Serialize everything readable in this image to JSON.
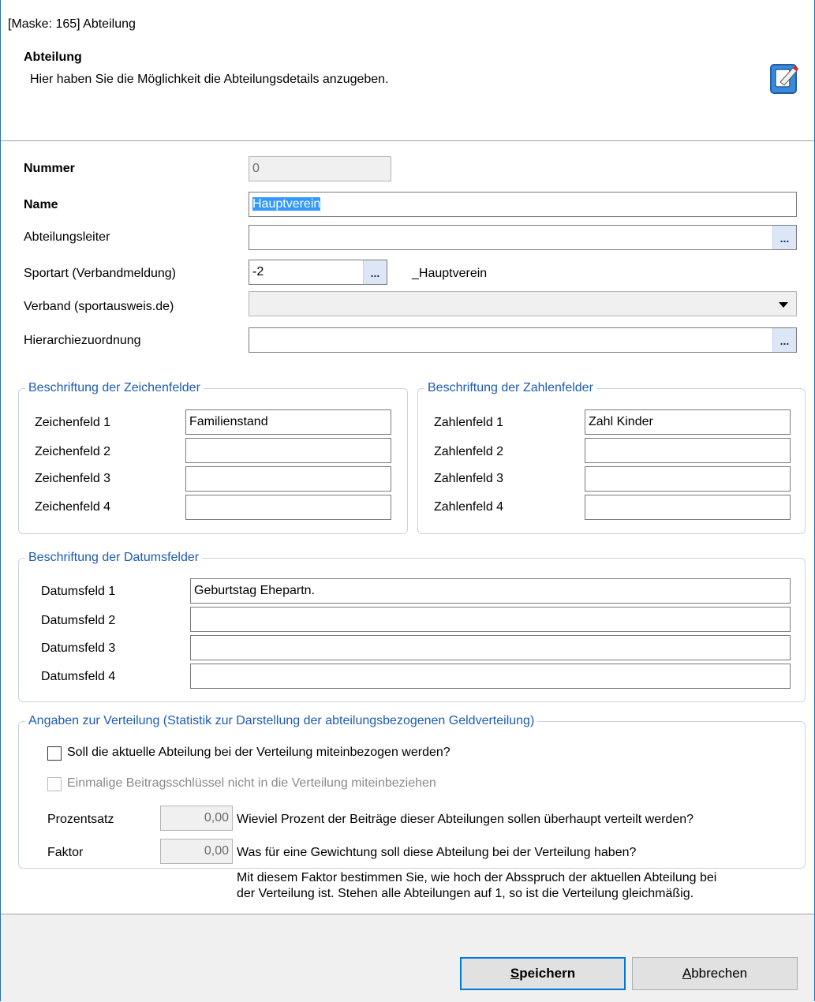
{
  "window": {
    "title": "[Maske: 165] Abteilung"
  },
  "header": {
    "title": "Abteilung",
    "subtitle": "Hier haben Sie die Möglichkeit die Abteilungsdetails anzugeben.",
    "icon": "edit-form-icon"
  },
  "form": {
    "nummer": {
      "label": "Nummer",
      "value": "0"
    },
    "name": {
      "label": "Name",
      "value": "Hauptverein"
    },
    "abteilungsleiter": {
      "label": "Abteilungsleiter",
      "value": "",
      "button": "..."
    },
    "sportart": {
      "label": "Sportart (Verbandmeldung)",
      "value": "-2",
      "button": "...",
      "description": "_Hauptverein"
    },
    "verband": {
      "label": "Verband (sportausweis.de)",
      "value": ""
    },
    "hierarchie": {
      "label": "Hierarchiezuordnung",
      "value": "",
      "button": "..."
    }
  },
  "zeichenfelder": {
    "legend": "Beschriftung der Zeichenfelder",
    "fields": [
      {
        "label": "Zeichenfeld 1",
        "value": "Familienstand"
      },
      {
        "label": "Zeichenfeld 2",
        "value": ""
      },
      {
        "label": "Zeichenfeld 3",
        "value": ""
      },
      {
        "label": "Zeichenfeld 4",
        "value": ""
      }
    ]
  },
  "zahlenfelder": {
    "legend": "Beschriftung der Zahlenfelder",
    "fields": [
      {
        "label": "Zahlenfeld 1",
        "value": "Zahl Kinder"
      },
      {
        "label": "Zahlenfeld 2",
        "value": ""
      },
      {
        "label": "Zahlenfeld 3",
        "value": ""
      },
      {
        "label": "Zahlenfeld 4",
        "value": ""
      }
    ]
  },
  "datumsfelder": {
    "legend": "Beschriftung der Datumsfelder",
    "fields": [
      {
        "label": "Datumsfeld 1",
        "value": "Geburtstag Ehepartn."
      },
      {
        "label": "Datumsfeld 2",
        "value": ""
      },
      {
        "label": "Datumsfeld 3",
        "value": ""
      },
      {
        "label": "Datumsfeld 4",
        "value": ""
      }
    ]
  },
  "verteilung": {
    "legend": "Angaben zur Verteilung (Statistik zur Darstellung der abteilungsbezogenen Geldverteilung)",
    "check1": {
      "label": "Soll die aktuelle Abteilung bei der Verteilung miteinbezogen werden?",
      "checked": false
    },
    "check2": {
      "label": "Einmalige Beitragsschlüssel nicht in die Verteilung miteinbeziehen",
      "checked": false
    },
    "prozentsatz": {
      "label": "Prozentsatz",
      "value": "0,00",
      "question": "Wieviel Prozent der Beiträge dieser Abteilungen sollen überhaupt verteilt werden?"
    },
    "faktor": {
      "label": "Faktor",
      "value": "0,00",
      "question": "Was für eine Gewichtung soll diese Abteilung bei der Verteilung haben?"
    },
    "hint_line1": "Mit diesem Faktor bestimmen Sie, wie hoch der Absspruch der aktuellen Abteilung bei",
    "hint_line2": "der Verteilung ist. Stehen alle Abteilungen auf 1, so ist die Verteilung gleichmäßig."
  },
  "buttons": {
    "save_first": "S",
    "save_rest": "peichern",
    "cancel_first": "A",
    "cancel_rest": "bbrechen"
  },
  "colors": {
    "accent": "#0078d7",
    "legend": "#1c5bb5",
    "selection": "#3399ff"
  }
}
